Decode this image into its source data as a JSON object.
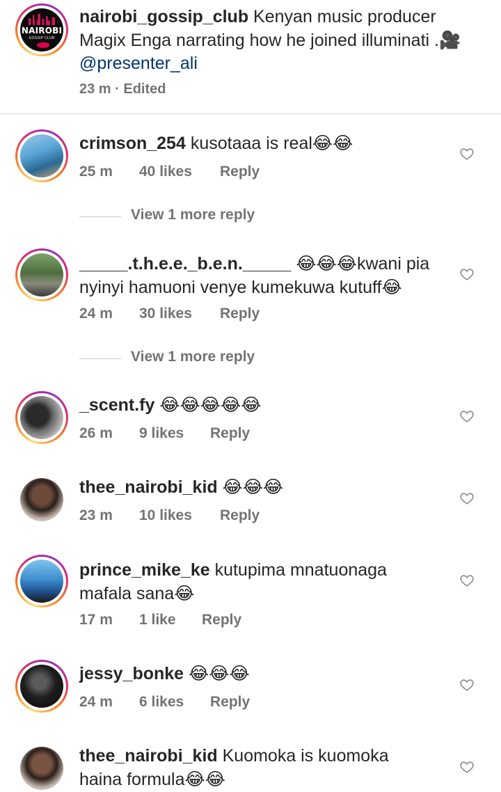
{
  "post": {
    "username": "nairobi_gossip_club",
    "caption": " Kenyan music producer Magix Enga narrating how he joined illuminati .",
    "camera_emoji": "🎥",
    "mention": " @presenter_ali",
    "time": "23 m",
    "separator": " · ",
    "edited": "Edited",
    "avatar_logo_text": "NAIROBI",
    "avatar_logo_sub": "GOSSIP CLUB"
  },
  "comments": [
    {
      "username": "crimson_254",
      "text": " kusotaaa is real",
      "emoji": "😂😂",
      "time": "25 m",
      "likes": "40 likes",
      "reply": "Reply"
    },
    {
      "username": "_____.t.h.e.e._b.e.n._____",
      "text": " ",
      "emoji": "😂😂😂",
      "text2": "kwani pia nyinyi hamuoni venye kumekuwa kutuff",
      "emoji2": "😂",
      "time": "24 m",
      "likes": "30 likes",
      "reply": "Reply"
    },
    {
      "username": "_scent.fy",
      "text": " ",
      "emoji": "😂😂😂😂😂",
      "time": "26 m",
      "likes": "9 likes",
      "reply": "Reply"
    },
    {
      "username": "thee_nairobi_kid",
      "text": " ",
      "emoji": "😂😂😂",
      "time": "23 m",
      "likes": "10 likes",
      "reply": "Reply"
    },
    {
      "username": "prince_mike_ke",
      "text": " kutupima mnatuonaga mafala sana",
      "emoji": "😂",
      "time": "17 m",
      "likes": "1 like",
      "reply": "Reply"
    },
    {
      "username": "jessy_bonke",
      "text": " ",
      "emoji": "😂😂😂",
      "time": "24 m",
      "likes": "6 likes",
      "reply": "Reply"
    },
    {
      "username": "thee_nairobi_kid",
      "text": " Kuomoka is kuomoka haina formula",
      "emoji": "😂😂",
      "time": "",
      "likes": "",
      "reply": ""
    }
  ],
  "view_more": [
    "View 1 more reply",
    "View 1 more reply"
  ],
  "colors": {
    "text": "#262626",
    "secondary": "#737373",
    "mention": "#00376b",
    "divider": "#dbdbdb"
  },
  "icons": {
    "like": "heart-outline-icon"
  }
}
